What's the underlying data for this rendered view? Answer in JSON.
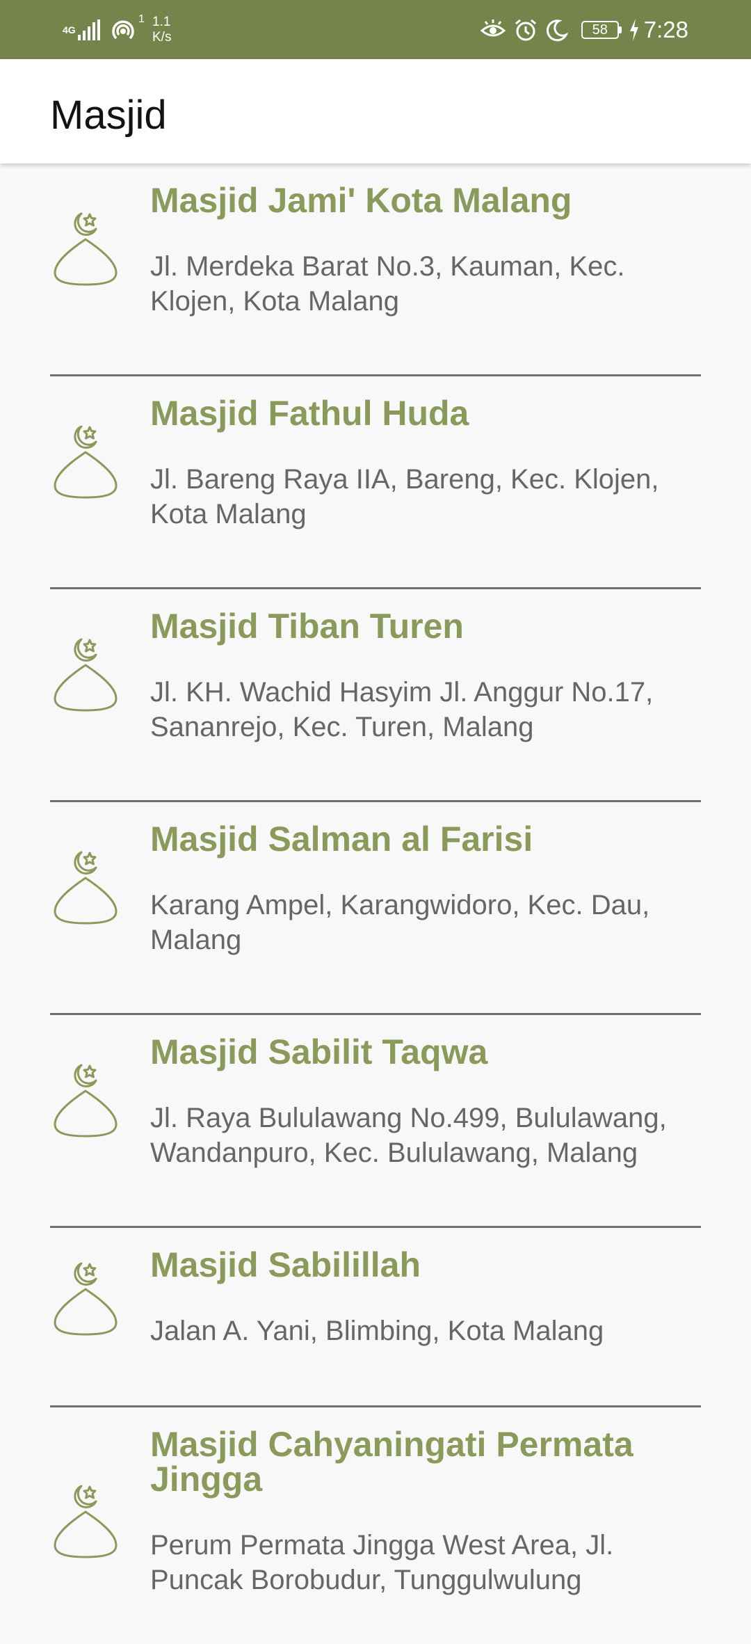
{
  "status_bar": {
    "network": "4G",
    "hotspot_count": "1",
    "speed_value": "1.1",
    "speed_unit": "K/s",
    "battery": "58",
    "time": "7:28"
  },
  "app_bar": {
    "title": "Masjid"
  },
  "colors": {
    "status_bar_bg": "#74844a",
    "accent": "#8a9a5b",
    "address_text": "#666666",
    "divider": "#6f6f6f"
  },
  "mosques": [
    {
      "name": "Masjid Jami' Kota Malang",
      "address": "Jl. Merdeka Barat No.3, Kauman, Kec. Klojen, Kota Malang",
      "icon": "mosque-dome-icon"
    },
    {
      "name": "Masjid Fathul Huda",
      "address": "Jl. Bareng Raya IIA, Bareng, Kec. Klojen, Kota Malang",
      "icon": "mosque-dome-icon"
    },
    {
      "name": "Masjid Tiban Turen",
      "address": "Jl. KH. Wachid Hasyim Jl. Anggur No.17, Sananrejo, Kec. Turen, Malang",
      "icon": "mosque-dome-icon"
    },
    {
      "name": "Masjid Salman al Farisi",
      "address": "Karang Ampel, Karangwidoro, Kec. Dau, Malang",
      "icon": "mosque-dome-icon"
    },
    {
      "name": "Masjid Sabilit Taqwa",
      "address": "Jl. Raya Bululawang No.499, Bululawang, Wandanpuro, Kec. Bululawang, Malang",
      "icon": "mosque-dome-icon"
    },
    {
      "name": "Masjid Sabilillah",
      "address": "Jalan A. Yani, Blimbing, Kota Malang",
      "icon": "mosque-dome-icon"
    },
    {
      "name": "Masjid Cahyaningati Permata Jingga",
      "address": "Perum Permata Jingga West Area, Jl. Puncak Borobudur, Tunggulwulung",
      "icon": "mosque-dome-icon"
    }
  ]
}
